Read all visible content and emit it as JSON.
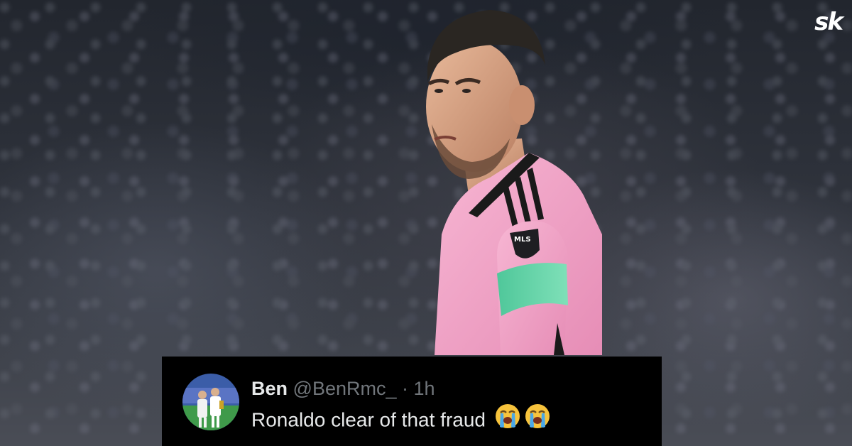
{
  "brand": {
    "logo_text": "sk",
    "color": "#ffffff"
  },
  "image": {
    "subject": "footballer in pink jersey with captain armband",
    "jersey_color": "#f3a6c9",
    "armband_color": "#55d0a0"
  },
  "tweet": {
    "display_name": "Ben",
    "handle": "@BenRmc_",
    "separator": "·",
    "time": "1h",
    "text": "Ronaldo clear of that fraud",
    "emojis": [
      "loudly-crying-face",
      "loudly-crying-face"
    ],
    "colors": {
      "background": "#000000",
      "name": "#e7e9ea",
      "meta": "#71767b"
    }
  }
}
